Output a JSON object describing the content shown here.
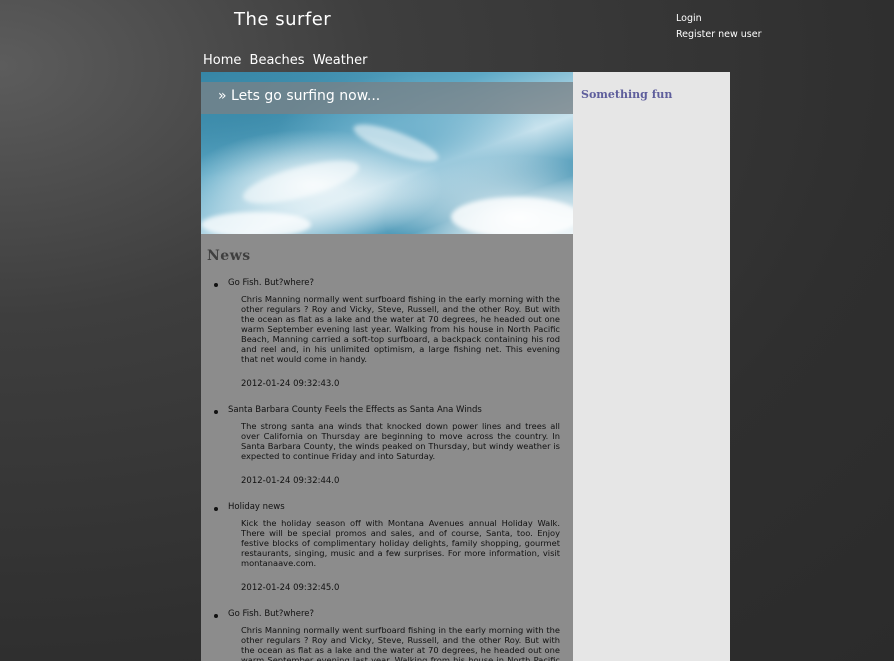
{
  "header": {
    "site_title": "The surfer",
    "login": "Login",
    "register": "Register new user"
  },
  "nav": {
    "items": [
      "Home",
      "Beaches",
      "Weather"
    ]
  },
  "banner": {
    "text": "» Lets go surfing now..."
  },
  "news": {
    "heading": "News",
    "items": [
      {
        "title": "Go Fish. But?where?",
        "body": "Chris Manning normally went surfboard fishing in the early morning with the other regulars ? Roy and Vicky, Steve, Russell, and the other Roy. But with the ocean as flat as a lake and the water at 70 degrees, he headed out one warm September evening last year. Walking from his house in North Pacific Beach, Manning carried a soft-top surfboard, a backpack containing his rod and reel and, in his unlimited optimism, a large fishing net. This evening that net would come in handy.",
        "date": "2012-01-24 09:32:43.0"
      },
      {
        "title": "Santa Barbara County Feels the Effects as Santa Ana Winds",
        "body": "The strong santa ana winds that knocked down power lines and trees all over California on Thursday are beginning to move across the country. In Santa Barbara County, the winds peaked on Thursday, but windy weather is expected to continue Friday and into Saturday.",
        "date": "2012-01-24 09:32:44.0"
      },
      {
        "title": "Holiday news",
        "body": "Kick the holiday season off with Montana Avenues annual Holiday Walk. There will be special promos and sales, and of course, Santa, too. Enjoy festive blocks of complimentary holiday delights, family shopping, gourmet restaurants, singing, music and a few surprises. For more information, visit montanaave.com.",
        "date": "2012-01-24 09:32:45.0"
      },
      {
        "title": "Go Fish. But?where?",
        "body": "Chris Manning normally went surfboard fishing in the early morning with the other regulars ? Roy and Vicky, Steve, Russell, and the other Roy. But with the ocean as flat as a lake and the water at 70 degrees, he headed out one warm September evening last year. Walking from his house in North Pacific Beach, Manning carried a soft-top surfboard,",
        "date": ""
      }
    ]
  },
  "sidebar": {
    "title": "Something fun"
  }
}
